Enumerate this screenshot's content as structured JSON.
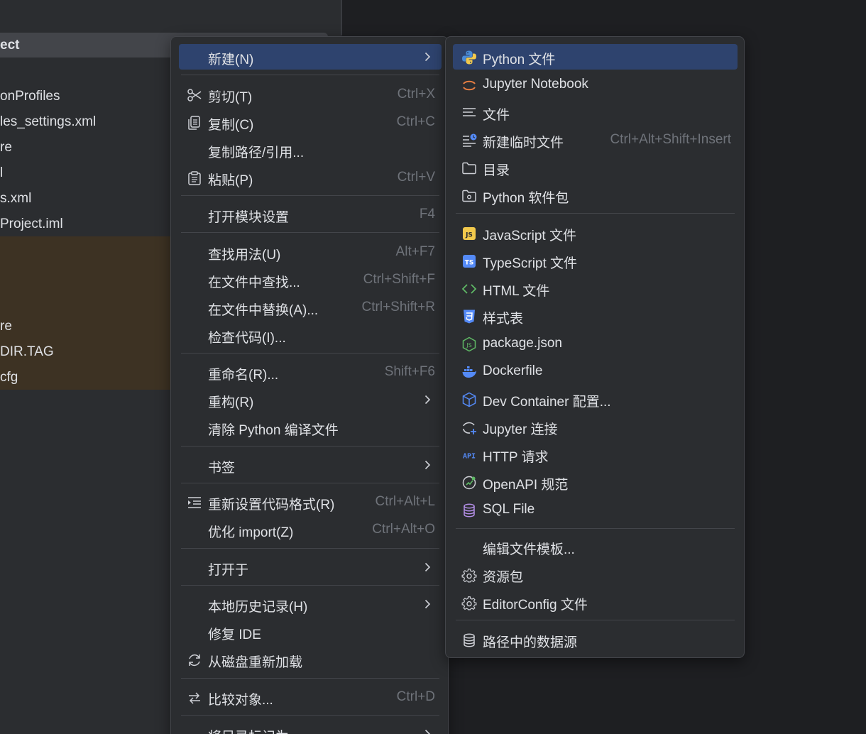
{
  "project": {
    "header": "ect",
    "items": [
      "onProfiles",
      "les_settings.xml",
      "re",
      "l",
      "s.xml",
      "Project.iml",
      "re",
      "DIR.TAG",
      "cfg"
    ]
  },
  "main_menu": {
    "new": {
      "label": "新建(N)"
    },
    "cut": {
      "label": "剪切(T)",
      "shortcut": "Ctrl+X"
    },
    "copy": {
      "label": "复制(C)",
      "shortcut": "Ctrl+C"
    },
    "copy_path": {
      "label": "复制路径/引用..."
    },
    "paste": {
      "label": "粘贴(P)",
      "shortcut": "Ctrl+V"
    },
    "module_settings": {
      "label": "打开模块设置",
      "shortcut": "F4"
    },
    "find_usages": {
      "label": "查找用法(U)",
      "shortcut": "Alt+F7"
    },
    "find_in_files": {
      "label": "在文件中查找...",
      "shortcut": "Ctrl+Shift+F"
    },
    "replace_in_files": {
      "label": "在文件中替换(A)...",
      "shortcut": "Ctrl+Shift+R"
    },
    "inspect_code": {
      "label": "检查代码(I)..."
    },
    "rename": {
      "label": "重命名(R)...",
      "shortcut": "Shift+F6"
    },
    "refactor": {
      "label": "重构(R)"
    },
    "clean_python": {
      "label": "清除 Python 编译文件"
    },
    "bookmarks": {
      "label": "书签"
    },
    "reformat": {
      "label": "重新设置代码格式(R)",
      "shortcut": "Ctrl+Alt+L"
    },
    "optimize_imports": {
      "label": "优化 import(Z)",
      "shortcut": "Ctrl+Alt+O"
    },
    "open_in": {
      "label": "打开于"
    },
    "local_history": {
      "label": "本地历史记录(H)"
    },
    "repair_ide": {
      "label": "修复 IDE"
    },
    "reload": {
      "label": "从磁盘重新加载"
    },
    "compare_with": {
      "label": "比较对象...",
      "shortcut": "Ctrl+D"
    },
    "mark_dir": {
      "label": "将目录标记为"
    }
  },
  "sub_menu": {
    "python_file": {
      "label": "Python 文件"
    },
    "jupyter_notebook": {
      "label": "Jupyter Notebook"
    },
    "file": {
      "label": "文件"
    },
    "scratch_file": {
      "label": "新建临时文件",
      "shortcut": "Ctrl+Alt+Shift+Insert"
    },
    "directory": {
      "label": "目录"
    },
    "python_package": {
      "label": "Python 软件包"
    },
    "javascript_file": {
      "label": "JavaScript 文件"
    },
    "typescript_file": {
      "label": "TypeScript 文件"
    },
    "html_file": {
      "label": "HTML 文件"
    },
    "stylesheet": {
      "label": "样式表"
    },
    "package_json": {
      "label": "package.json"
    },
    "dockerfile": {
      "label": "Dockerfile"
    },
    "dev_container": {
      "label": "Dev Container 配置..."
    },
    "jupyter_connection": {
      "label": "Jupyter 连接"
    },
    "http_request": {
      "label": "HTTP 请求"
    },
    "openapi": {
      "label": "OpenAPI 规范"
    },
    "sql_file": {
      "label": "SQL File"
    },
    "edit_templates": {
      "label": "编辑文件模板..."
    },
    "resource_bundle": {
      "label": "资源包"
    },
    "editorconfig": {
      "label": "EditorConfig 文件"
    },
    "data_source_path": {
      "label": "路径中的数据源"
    }
  },
  "colors": {
    "accent": "#2e436e",
    "menu_bg": "#2b2d30",
    "excluded": "#3d3223",
    "shortcut": "#6f737a"
  }
}
